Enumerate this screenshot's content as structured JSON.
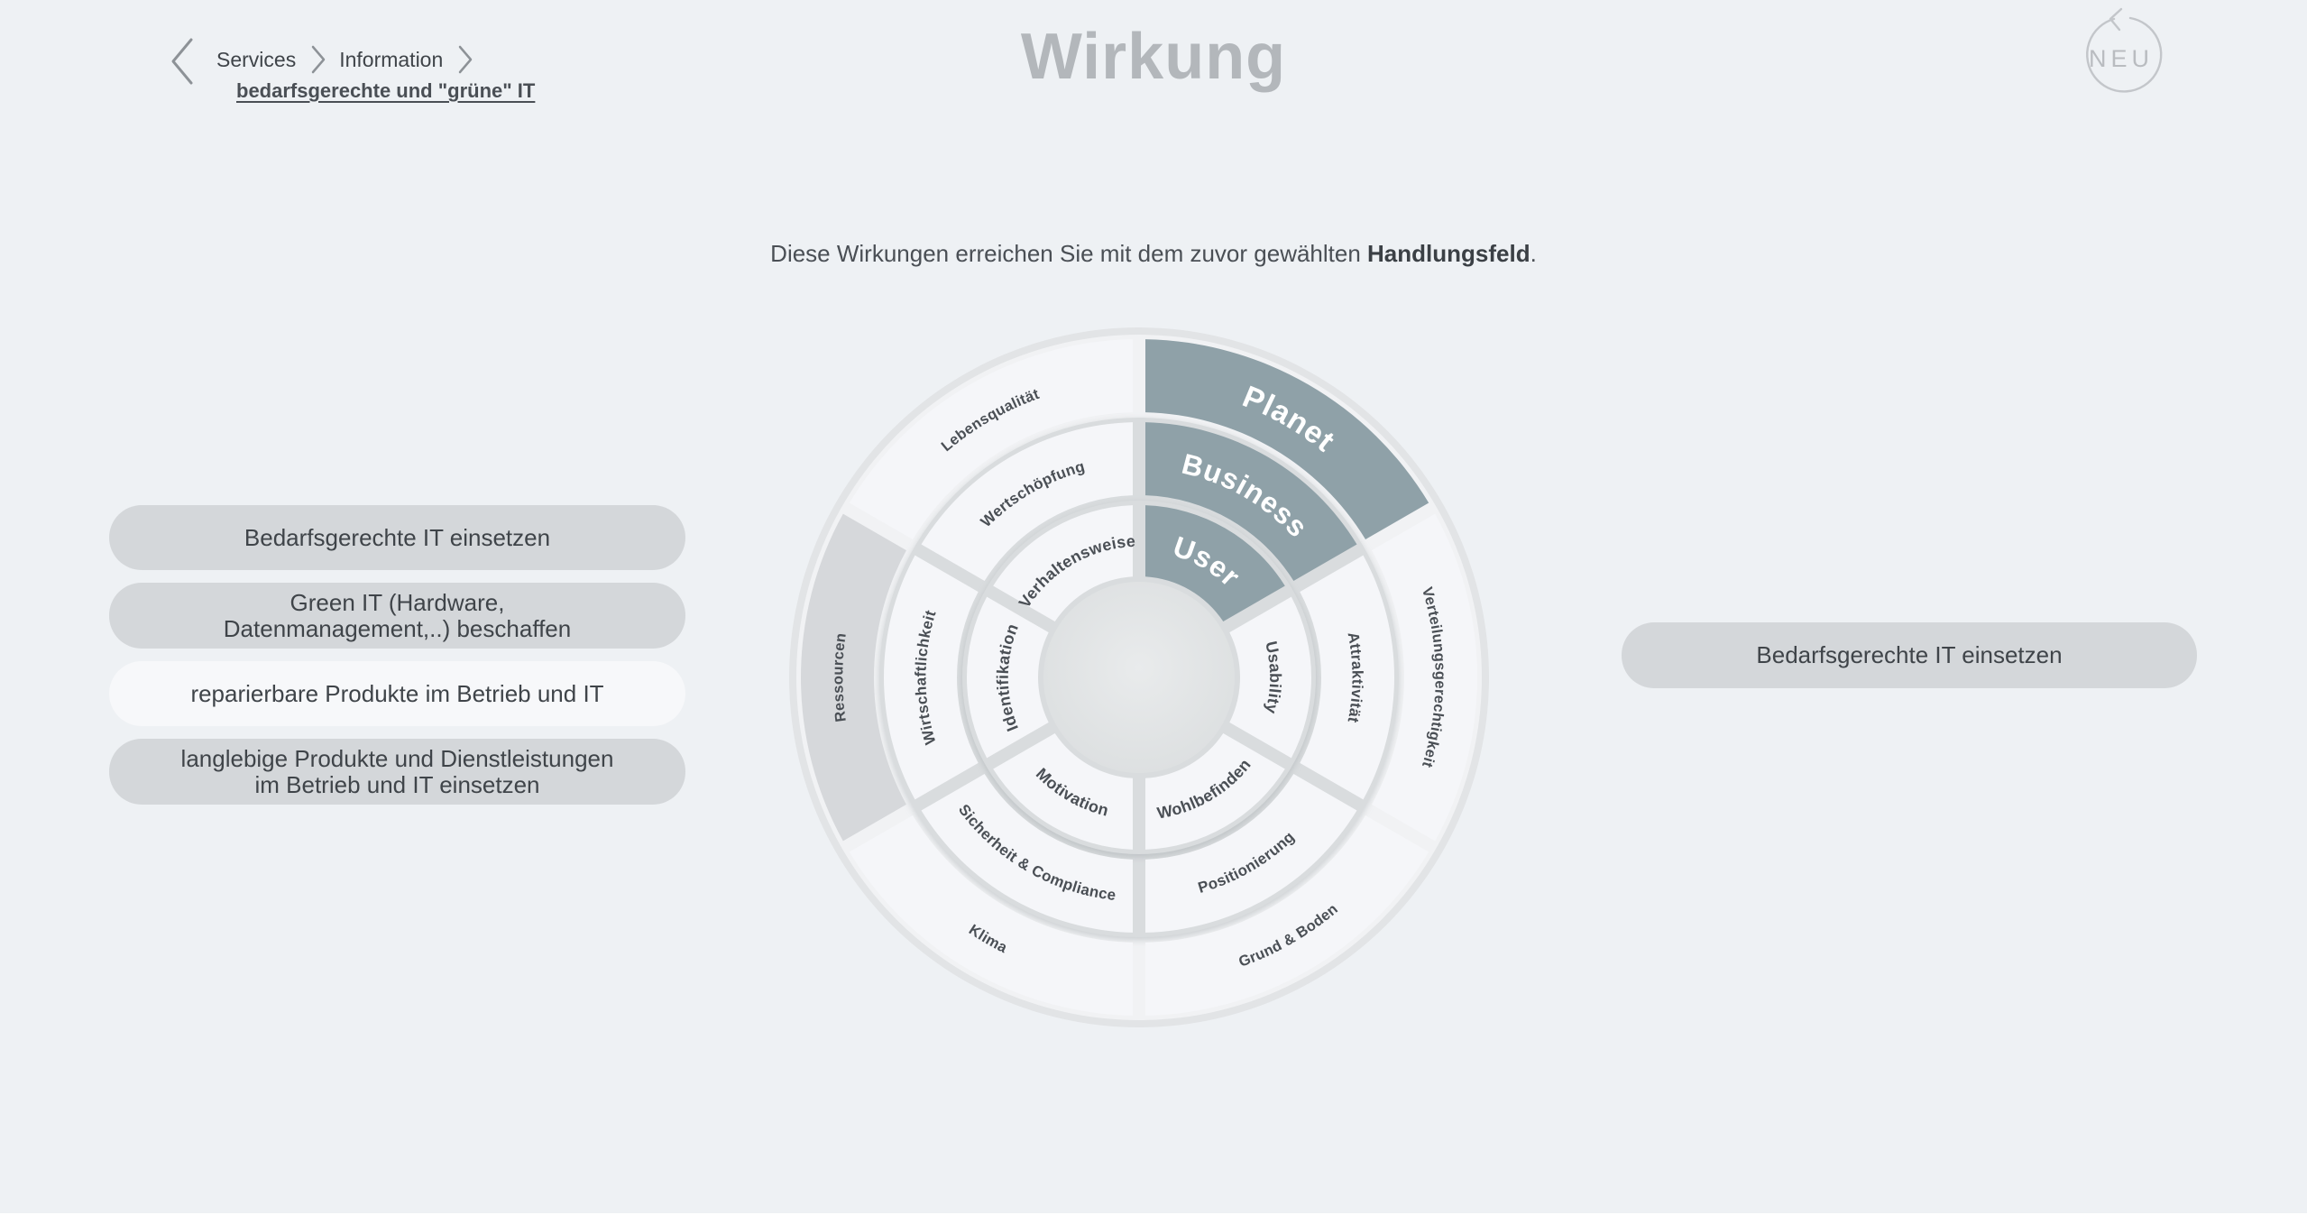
{
  "header": {
    "title": "Wirkung",
    "breadcrumb": [
      "Services",
      "Information"
    ],
    "subcrumb": "bedarfsgerechte und \"grüne\" IT",
    "new_label": "NEU"
  },
  "intro": {
    "text": "Diese Wirkungen erreichen Sie mit dem zuvor gewählten ",
    "bold": "Handlungsfeld",
    "end": "."
  },
  "measures": [
    {
      "label": "Bedarfsgerechte IT einsetzen",
      "active": false
    },
    {
      "label": "Green IT (Hardware,\nDatenmanagement,..) beschaffen",
      "active": false
    },
    {
      "label": "reparierbare Produkte im Betrieb und IT",
      "active": true
    },
    {
      "label": "langlebige Produkte und Dienstleistungen\nim Betrieb und IT einsetzen",
      "active": false
    }
  ],
  "selected_measure": "Bedarfsgerechte IT einsetzen",
  "wheel": {
    "colors": {
      "segment": "#f5f6f9",
      "highlight": "#8fa1a8",
      "dimmed": "#d6d8db",
      "center": "#e3e5e6",
      "text": "#4a4f55",
      "highlight_text": "#ffffff"
    },
    "rings": [
      {
        "name": "Planet",
        "segments": [
          {
            "label": "Planet",
            "highlight": true
          },
          {
            "label": "Verteilungsgerechtigkeit"
          },
          {
            "label": "Grund & Boden"
          },
          {
            "label": "Klima"
          },
          {
            "label": "Ressourcen",
            "dimmed": true
          },
          {
            "label": "Lebensqualität"
          }
        ]
      },
      {
        "name": "Business",
        "segments": [
          {
            "label": "Business",
            "highlight": true
          },
          {
            "label": "Attraktivität"
          },
          {
            "label": "Positionierung"
          },
          {
            "label": "Sicherheit & Compliance"
          },
          {
            "label": "Wirtschaftlichkeit"
          },
          {
            "label": "Wertschöpfung"
          }
        ]
      },
      {
        "name": "User",
        "segments": [
          {
            "label": "User",
            "highlight": true
          },
          {
            "label": "Usability"
          },
          {
            "label": "Wohlbefinden"
          },
          {
            "label": "Motivation"
          },
          {
            "label": "Identifikation"
          },
          {
            "label": "Verhaltensweise"
          }
        ]
      }
    ]
  }
}
